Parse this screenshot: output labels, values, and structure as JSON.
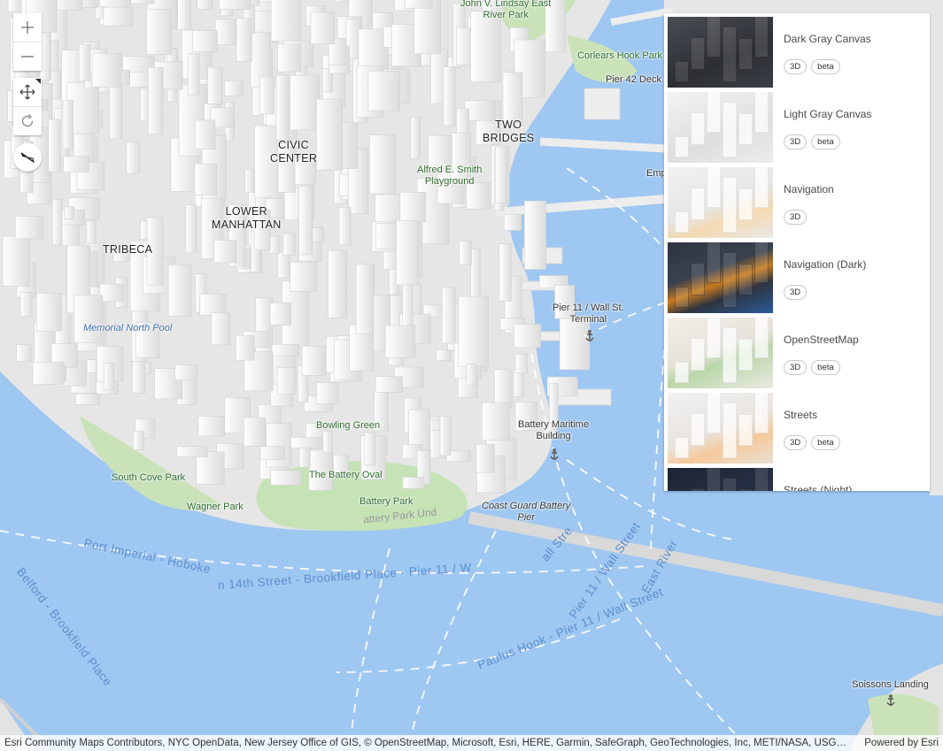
{
  "map": {
    "labels": {
      "district_civic": "CIVIC\nCENTER",
      "district_lower_manhattan": "LOWER\nMANHATTAN",
      "district_tribeca": "TRIBECA",
      "district_two_bridges": "TWO\nBRIDGES",
      "park_lindsay": "John V. Lindsay East\nRiver Park",
      "park_corlears": "Corlears Hook Park",
      "place_pier42": "Pier 42 Deck",
      "park_alfred": "Alfred E. Smith\nPlayground",
      "water_memorial_pool": "Memorial North Pool",
      "place_pier11": "Pier 11 / Wall St.\nTerminal",
      "park_bowling_green": "Bowling Green",
      "place_battery_maritime": "Battery Maritime\nBuilding",
      "park_south_cove": "South Cove Park",
      "park_battery_oval": "The Battery Oval",
      "park_battery": "Battery Park",
      "park_wagner": "Wagner Park",
      "place_coast_guard": "Coast Guard Battery\nPier",
      "place_soissons": "Soissons Landing",
      "place_emp_partial": "Emp",
      "ferry_route_1": "Port Imperial - Hoboke",
      "ferry_route_2": "n 14th Street - Brookfield Place - Pier 11 / W",
      "ferry_route_3": "all Stre",
      "ferry_route_4": "Pier 11 / Wall Street",
      "ferry_route_5": "Paulus Hook - Pier 11 / Wall Street",
      "ferry_route_6": "Belford - Brookfield Place",
      "ferry_route_7": "East River",
      "street_battery_park_und": "attery Park Und"
    }
  },
  "controls": {
    "zoom_in": "zoom-in",
    "zoom_out": "zoom-out",
    "pan": "pan",
    "rotate": "rotate",
    "compass": "compass"
  },
  "gallery": {
    "items": [
      {
        "title": "Dark Gray Canvas",
        "tags": [
          "3D",
          "beta"
        ],
        "thumb": "dark"
      },
      {
        "title": "Light Gray Canvas",
        "tags": [
          "3D",
          "beta"
        ],
        "thumb": "light"
      },
      {
        "title": "Navigation",
        "tags": [
          "3D"
        ],
        "thumb": "nav"
      },
      {
        "title": "Navigation (Dark)",
        "tags": [
          "3D"
        ],
        "thumb": "navdark"
      },
      {
        "title": "OpenStreetMap",
        "tags": [
          "3D",
          "beta"
        ],
        "thumb": "osm"
      },
      {
        "title": "Streets",
        "tags": [
          "3D",
          "beta"
        ],
        "thumb": "streets"
      },
      {
        "title": "Streets (Night)",
        "tags": [],
        "thumb": "night"
      }
    ]
  },
  "attribution": {
    "text": "Esri Community Maps Contributors, NYC OpenData, New Jersey Office of GIS, © OpenStreetMap, Microsoft, Esri, HERE, Garmin, SafeGraph, GeoTechnologies, Inc, METI/NASA, USGS, EPA, NPS, US Census Bureau, USDA, USFWS",
    "powered": "Powered by Esri"
  },
  "colors": {
    "water": "#9ec7f2",
    "land": "#e9e9e9",
    "park": "#c5e3b5",
    "building": "#f4f4f4",
    "ferry_line": "#ffffff",
    "ferry_label": "#5c8fcc"
  }
}
